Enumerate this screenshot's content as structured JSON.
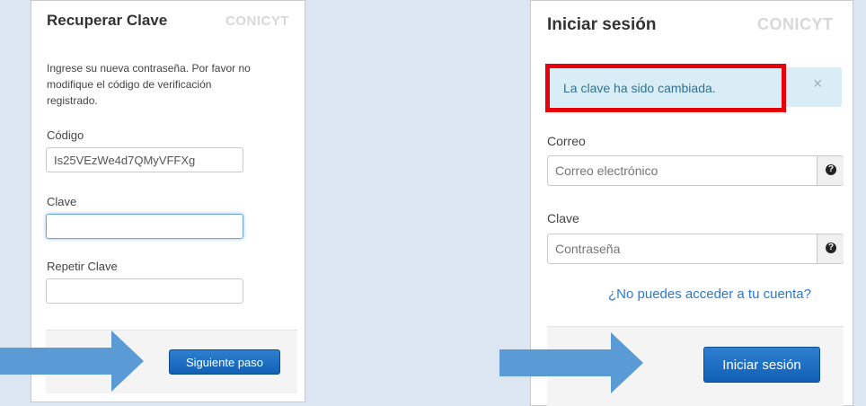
{
  "recover": {
    "title": "Recuperar Clave",
    "brand": "CONICYT",
    "instructions_line1": "Ingrese su nueva contraseña. Por favor no",
    "instructions_line2": "modifique el código de verificación",
    "instructions_line3": "registrado.",
    "code_label": "Código",
    "code_value": "Is25VEzWe4d7QMyVFFXg",
    "password_label": "Clave",
    "password_value": "",
    "repeat_label": "Repetir Clave",
    "repeat_value": "",
    "next_button": "Siguiente paso"
  },
  "login": {
    "title": "Iniciar sesión",
    "brand": "CONICYT",
    "alert_text": "La clave ha sido cambiada.",
    "alert_close": "×",
    "email_label": "Correo",
    "email_placeholder": "Correo electrónico",
    "password_label": "Clave",
    "password_placeholder": "Contraseña",
    "help_glyph": "?",
    "forgot_link": "¿No puedes acceder a tu cuenta?",
    "login_button": "Iniciar sesión"
  },
  "colors": {
    "alert_bg": "#d9edf7",
    "alert_text": "#31708f",
    "highlight_border": "#e8000b",
    "arrow": "#5b9bd5",
    "button": "#1a6cc2",
    "link": "#2a7ad3"
  }
}
